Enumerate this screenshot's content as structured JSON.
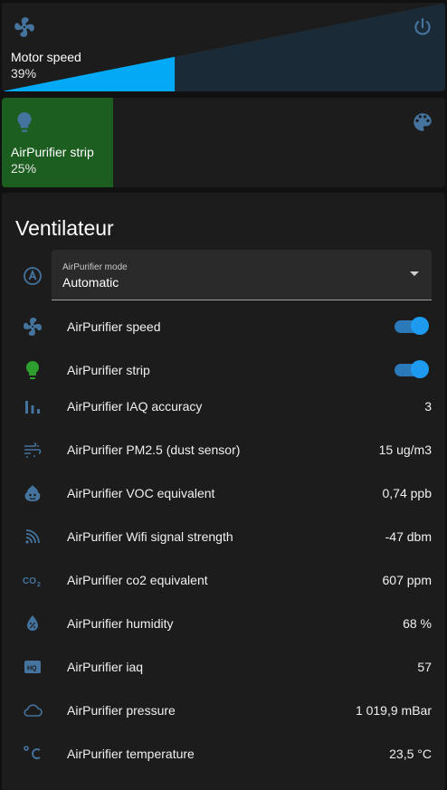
{
  "colors": {
    "accent": "#03a9f4",
    "icon_blue": "#44739e",
    "green": "#1b5e20",
    "green_icon": "#2e9e2e"
  },
  "motor": {
    "name": "Motor speed",
    "state": "39%",
    "level_percent": 39,
    "icon": "fan-icon",
    "action_icon": "power-icon"
  },
  "strip": {
    "name": "AirPurifier strip",
    "state": "25%",
    "level_percent": 25,
    "icon": "lightbulb-icon",
    "action_icon": "palette-icon"
  },
  "ventilateur": {
    "title": "Ventilateur",
    "mode": {
      "label": "AirPurifier mode",
      "value": "Automatic",
      "icon": "fan-auto-icon"
    },
    "rows": [
      {
        "label": "AirPurifier speed",
        "icon": "fan-icon",
        "toggle": true
      },
      {
        "label": "AirPurifier strip",
        "icon": "lightbulb-icon",
        "toggle": true
      },
      {
        "label": "AirPurifier IAQ accuracy",
        "icon": "bar-chart-icon",
        "value": "3"
      },
      {
        "label": "AirPurifier PM2.5 (dust sensor)",
        "icon": "dust-icon",
        "value": "15 ug/m3"
      },
      {
        "label": "AirPurifier VOC equivalent",
        "icon": "voc-icon",
        "value": "0,74 ppb"
      },
      {
        "label": "AirPurifier Wifi signal strength",
        "icon": "wifi-icon",
        "value": "-47 dbm"
      },
      {
        "label": "AirPurifier co2 equivalent",
        "icon": "co2-icon",
        "value": "607 ppm"
      },
      {
        "label": "AirPurifier humidity",
        "icon": "humidity-icon",
        "value": "68 %"
      },
      {
        "label": "AirPurifier iaq",
        "icon": "hq-icon",
        "value": "57"
      },
      {
        "label": "AirPurifier pressure",
        "icon": "cloud-icon",
        "value": "1 019,9 mBar"
      },
      {
        "label": "AirPurifier temperature",
        "icon": "thermometer-icon",
        "value": "23,5 °C"
      }
    ]
  }
}
